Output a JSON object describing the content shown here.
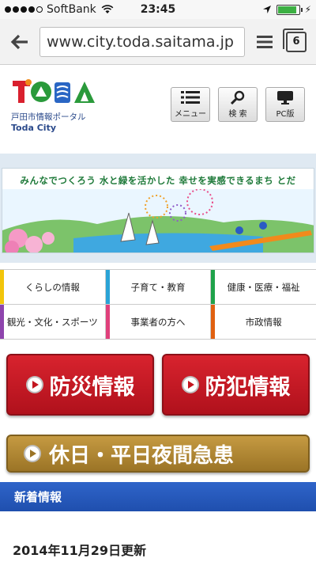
{
  "status_bar": {
    "carrier": "SoftBank",
    "time": "23:45",
    "battery_level": 0.9
  },
  "browser": {
    "url": "www.city.toda.saitama.jp",
    "tab_count": "6"
  },
  "site": {
    "logo_text": "TODA",
    "logo_subtitle": "戸田市情報ポータル",
    "logo_en": "Toda City",
    "menu_label": "メニュー",
    "search_label": "検 索",
    "pc_label": "PC版"
  },
  "banner": {
    "slogan": "みんなでつくろう 水と緑を活かした 幸せを実感できるまち とだ"
  },
  "menu": {
    "rows": [
      [
        {
          "label": "くらしの情報",
          "color": "#f2c50b"
        },
        {
          "label": "子育て・教育",
          "color": "#2aa3d6"
        },
        {
          "label": "健康・医療・福祉",
          "color": "#1fa24a"
        }
      ],
      [
        {
          "label": "観光・文化・スポーツ",
          "color": "#8e44ad"
        },
        {
          "label": "事業者の方へ",
          "color": "#e0407b"
        },
        {
          "label": "市政情報",
          "color": "#e06010"
        }
      ]
    ]
  },
  "buttons": {
    "disaster": "防災情報",
    "crime": "防犯情報",
    "holiday": "休日・平日夜間急患"
  },
  "news": {
    "heading": "新着情報",
    "updated": "2014年11月29日更新"
  }
}
